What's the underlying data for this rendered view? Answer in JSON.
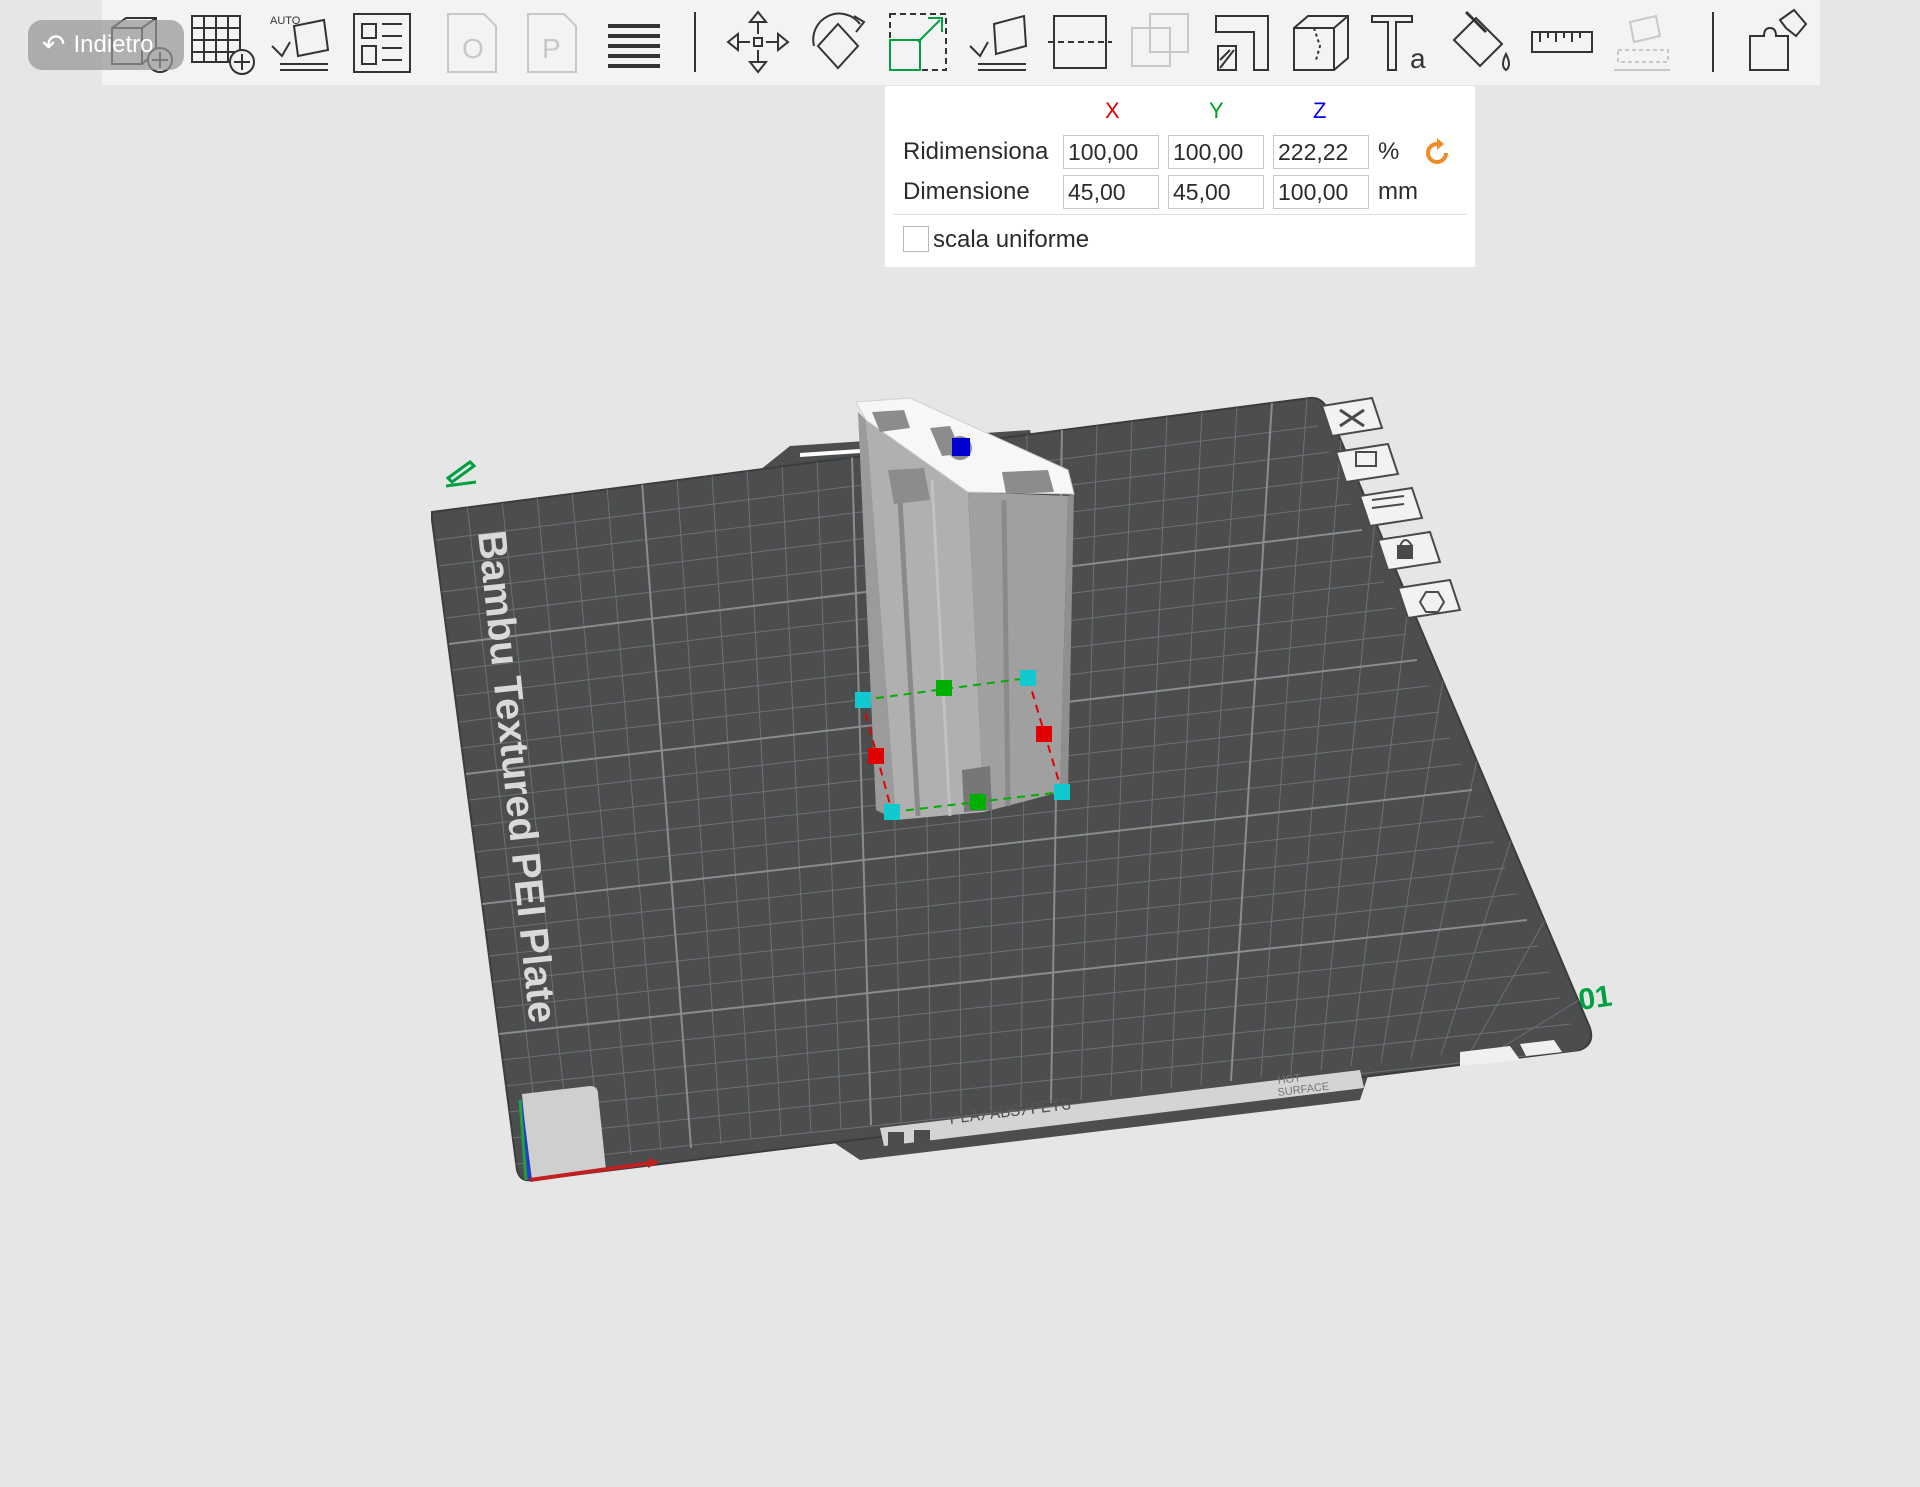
{
  "back_button": {
    "label": "Indietro"
  },
  "toolbar": {
    "auto_orient_badge": "AUTO",
    "tools": [
      "add-object",
      "add-plate",
      "auto-orient",
      "arrange",
      "split-to-objects",
      "split-to-parts",
      "variable-layer-height",
      "move",
      "rotate",
      "scale",
      "lay-on-face",
      "cut",
      "boolean",
      "support-painting",
      "seam-painting",
      "text",
      "color-painting",
      "measure",
      "assembly-view",
      "assemble"
    ]
  },
  "scale_panel": {
    "axes": {
      "x": "X",
      "y": "Y",
      "z": "Z"
    },
    "scale_row": {
      "label": "Ridimensiona",
      "x": "100,00",
      "y": "100,00",
      "z": "222,22",
      "unit": "%"
    },
    "size_row": {
      "label": "Dimensione",
      "x": "45,00",
      "y": "45,00",
      "z": "100,00",
      "unit": "mm"
    },
    "uniform_scale": {
      "label": "scala uniforme",
      "checked": false
    }
  },
  "plate": {
    "name": "Bambu Textured PEI Plate",
    "number": "01",
    "material_label": "PLA/ABS/PETG",
    "hot_surface_label_1": "HOT",
    "hot_surface_label_2": "SURFACE"
  },
  "colors": {
    "x_axis": "#e00000",
    "y_axis": "#00a020",
    "z_axis": "#0000e0",
    "accent_green": "#00a040",
    "accent_orange": "#f08a24",
    "plate": "#4b4d4f",
    "model": "#a6a6a6"
  }
}
